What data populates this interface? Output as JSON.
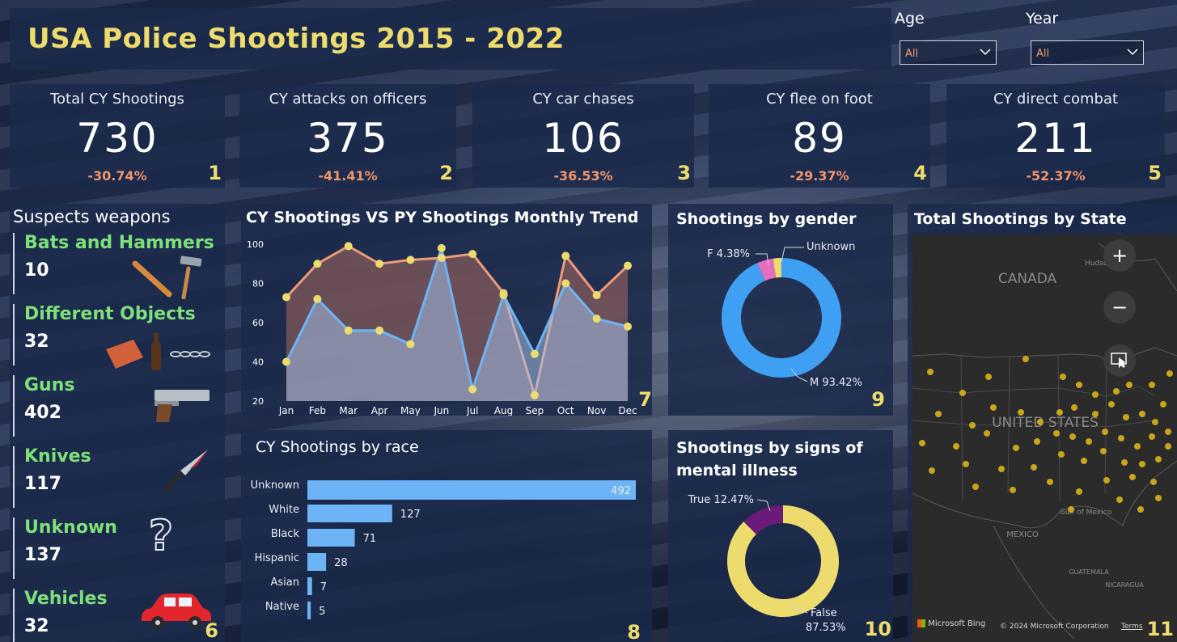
{
  "header": {
    "title": "USA Police Shootings 2015 - 2022"
  },
  "filters": [
    {
      "label": "Age",
      "value": "All"
    },
    {
      "label": "Year",
      "value": "All"
    }
  ],
  "kpis": [
    {
      "title": "Total CY Shootings",
      "value": "730",
      "delta": "-30.74%",
      "badge": "1"
    },
    {
      "title": "CY attacks on officers",
      "value": "375",
      "delta": "-41.41%",
      "badge": "2"
    },
    {
      "title": "CY car chases",
      "value": "106",
      "delta": "-36.53%",
      "badge": "3"
    },
    {
      "title": "CY flee on foot",
      "value": "89",
      "delta": "-29.37%",
      "badge": "4"
    },
    {
      "title": "CY direct combat",
      "value": "211",
      "delta": "-52.37%",
      "badge": "5"
    }
  ],
  "weapons": {
    "title": "Suspects weapons",
    "badge": "6",
    "items": [
      {
        "name": "Bats and Hammers",
        "count": "10",
        "icon": "bat-hammer-icon"
      },
      {
        "name": "Different Objects",
        "count": "32",
        "icon": "brick-bottle-chain-icon"
      },
      {
        "name": "Guns",
        "count": "402",
        "icon": "pistol-icon"
      },
      {
        "name": "Knives",
        "count": "117",
        "icon": "knife-icon"
      },
      {
        "name": "Unknown",
        "count": "137",
        "icon": "question-mark-icon"
      },
      {
        "name": "Vehicles",
        "count": "32",
        "icon": "car-icon"
      }
    ]
  },
  "trend": {
    "title": "CY Shootings VS PY Shootings Monthly Trend",
    "badge": "7"
  },
  "race": {
    "title": "CY Shootings by race",
    "badge": "8"
  },
  "gender": {
    "title": "Shootings by gender",
    "badge": "9"
  },
  "mental": {
    "title": "Shootings by signs of mental illness",
    "badge": "10"
  },
  "statemap": {
    "title": "Total Shootings by State",
    "badge": "11",
    "labels": {
      "canada": "CANADA",
      "us": "UNITED STATES",
      "mexico": "MEXICO",
      "gulf": "Gulf of Mexico",
      "hudson": "Hudson Bay",
      "guatemala": "GUATEMALA",
      "nicaragua": "NICARAGUA"
    },
    "credit": "Microsoft Bing",
    "copyright": "© 2024 Microsoft Corporation",
    "terms": "Terms"
  },
  "colors": {
    "accent": "#eddc6d",
    "positive": "#7ee07a",
    "delta": "#f0956a",
    "cy": "#6cb4f5",
    "py": "#ee9b7a",
    "point": "#eddc6d",
    "bar": "#6cb4f5",
    "male": "#3f9ff2",
    "female": "#e56fbf",
    "mental_false": "#eddc6d",
    "mental_true": "#6a1b7a"
  },
  "chart_data": [
    {
      "type": "area",
      "title": "CY Shootings VS PY Shootings Monthly Trend",
      "categories": [
        "Jan",
        "Feb",
        "Mar",
        "Apr",
        "May",
        "Jun",
        "Jul",
        "Aug",
        "Sep",
        "Oct",
        "Nov",
        "Dec"
      ],
      "series": [
        {
          "values": [
            73,
            90,
            99,
            90,
            92,
            93,
            95,
            75,
            23,
            94,
            74,
            89
          ]
        },
        {
          "values": [
            40,
            72,
            56,
            56,
            49,
            98,
            26,
            74,
            44,
            80,
            62,
            58
          ]
        }
      ],
      "ylim": [
        20,
        100
      ],
      "yticks": [
        100,
        80,
        60,
        40,
        20
      ]
    },
    {
      "type": "bar",
      "title": "CY Shootings by race",
      "categories": [
        "Unknown",
        "White",
        "Black",
        "Hispanic",
        "Asian",
        "Native"
      ],
      "values": [
        492,
        127,
        71,
        28,
        7,
        5
      ]
    },
    {
      "type": "pie",
      "title": "Shootings by gender",
      "labels": [
        "M",
        "F",
        "Unknown"
      ],
      "values": [
        93.42,
        4.38,
        2.2
      ],
      "data_labels": [
        "M 93.42%",
        "F 4.38%",
        "Unknown"
      ]
    },
    {
      "type": "pie",
      "title": "Shootings by signs of mental illness",
      "labels": [
        "False",
        "True"
      ],
      "values": [
        87.53,
        12.47
      ],
      "data_labels": [
        "False",
        "87.53%",
        "True 12.47%"
      ]
    }
  ]
}
